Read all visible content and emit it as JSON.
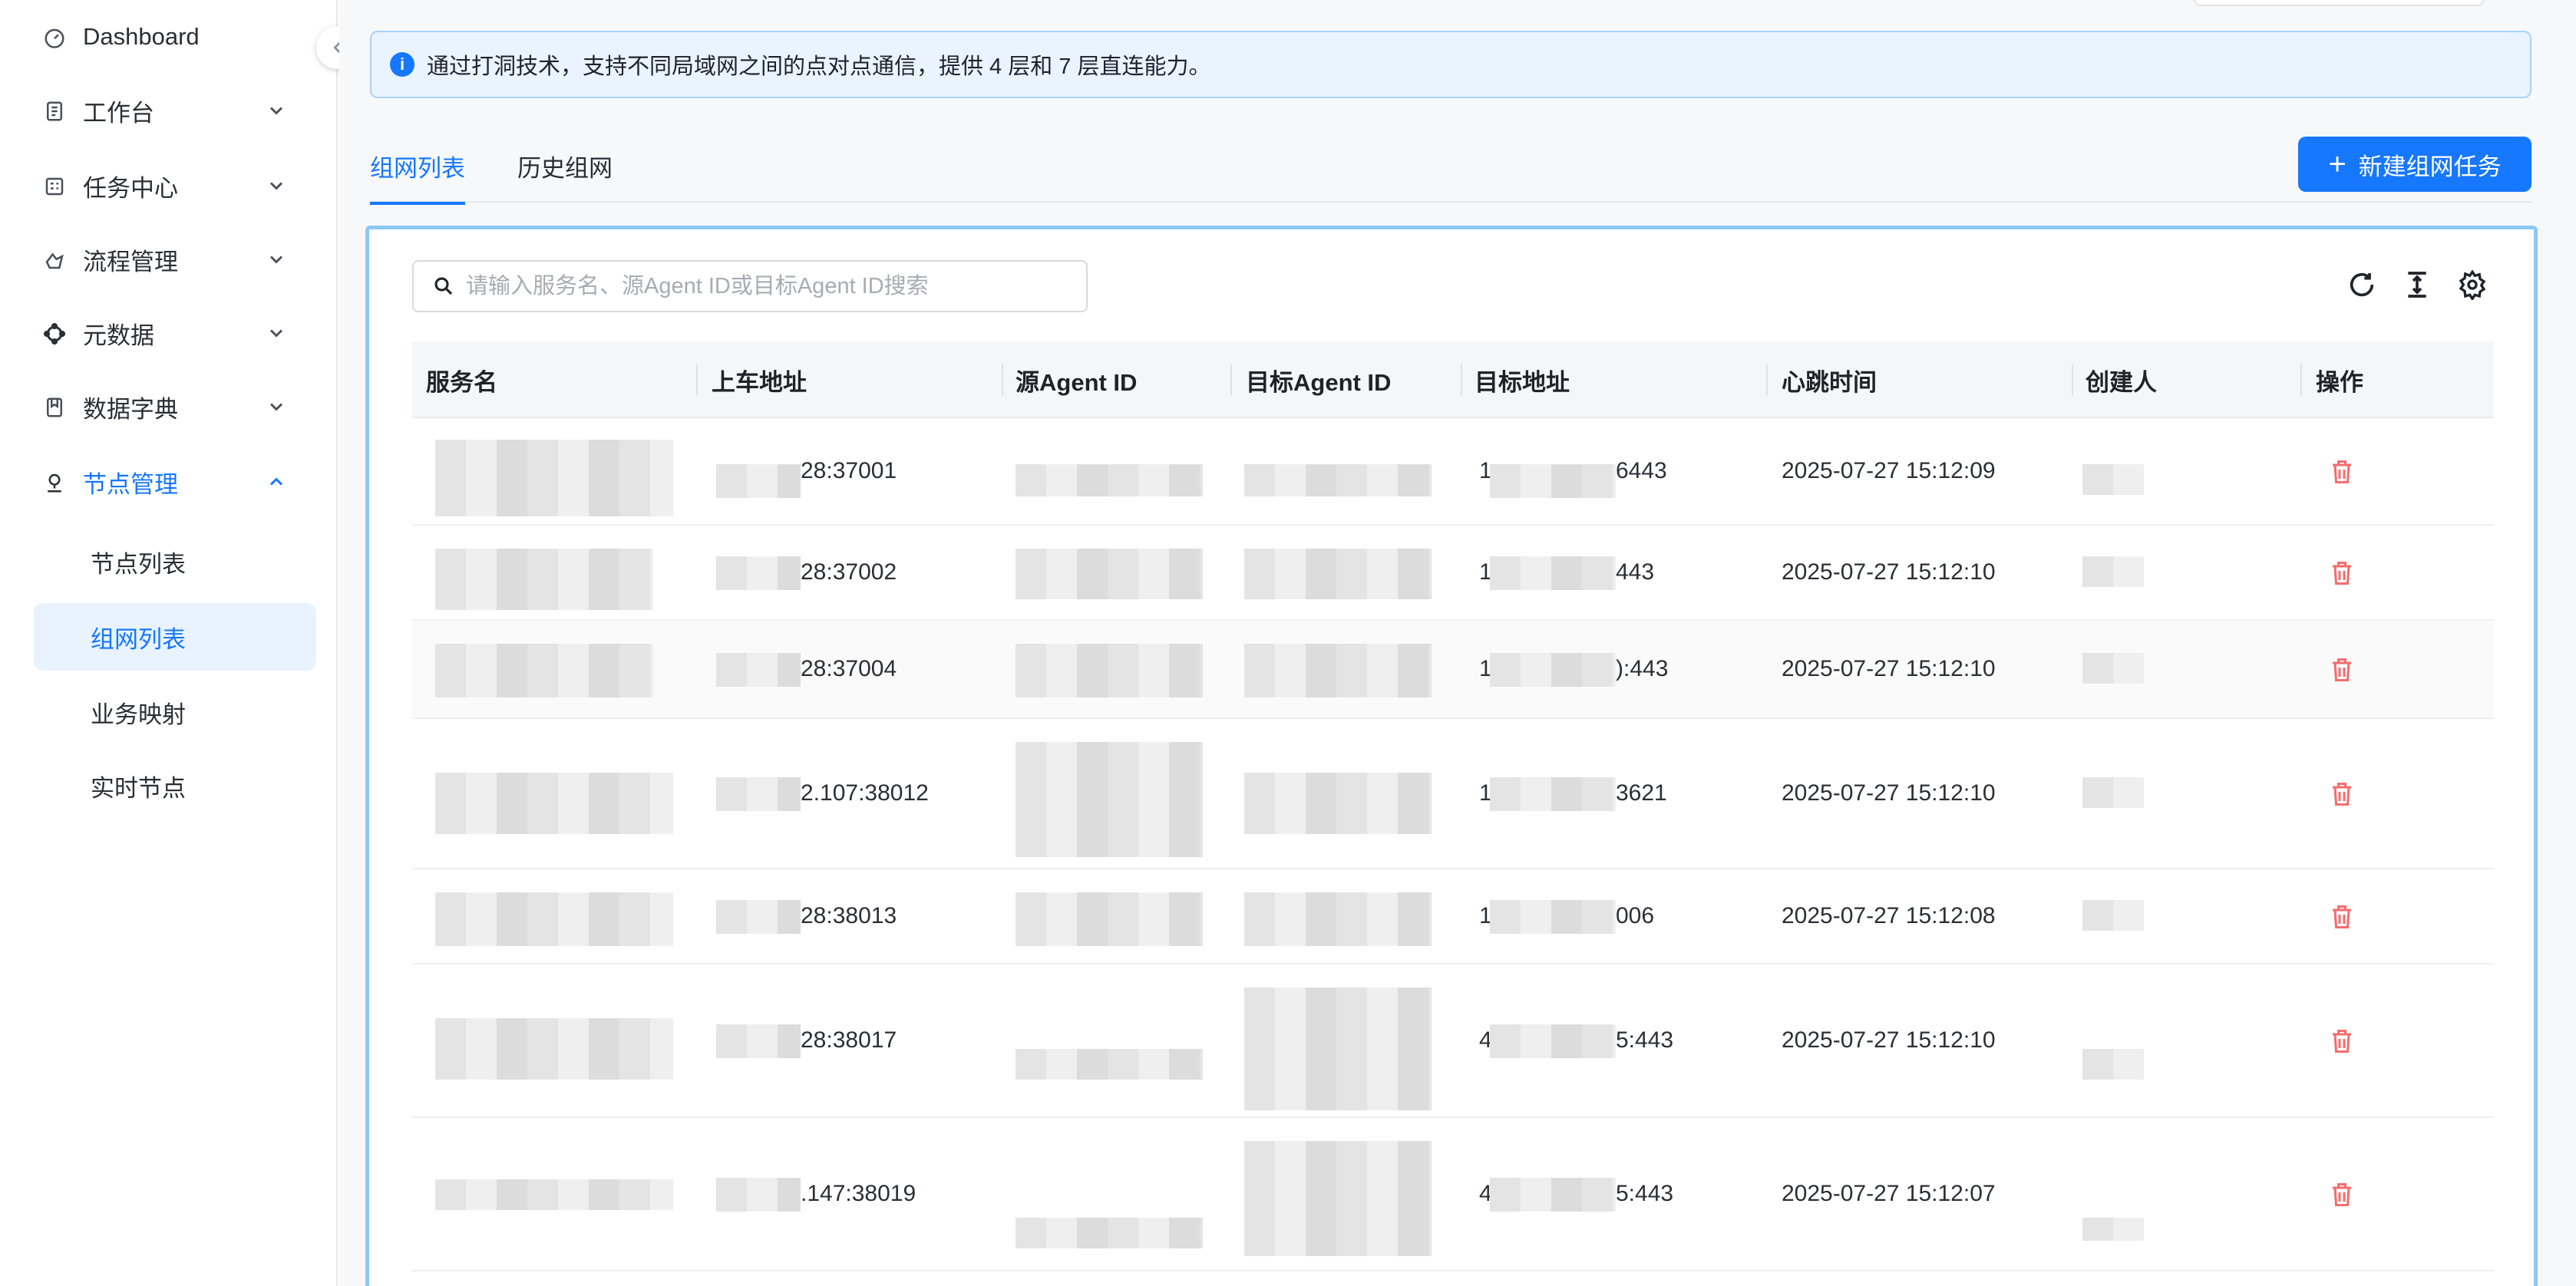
{
  "sidebar": {
    "items": [
      {
        "label": "Dashboard",
        "icon": "dashboard-icon",
        "chevron": ""
      },
      {
        "label": "工作台",
        "icon": "document-icon",
        "chevron": "down"
      },
      {
        "label": "任务中心",
        "icon": "task-icon",
        "chevron": "down"
      },
      {
        "label": "流程管理",
        "icon": "flow-icon",
        "chevron": "down"
      },
      {
        "label": "元数据",
        "icon": "metadata-icon",
        "chevron": "down"
      },
      {
        "label": "数据字典",
        "icon": "dictionary-icon",
        "chevron": "down"
      },
      {
        "label": "节点管理",
        "icon": "node-icon",
        "chevron": "up"
      }
    ],
    "sub_items": [
      {
        "label": "节点列表"
      },
      {
        "label": "组网列表"
      },
      {
        "label": "业务映射"
      },
      {
        "label": "实时节点"
      }
    ]
  },
  "alert": {
    "icon": "info-icon",
    "text": "通过打洞技术，支持不同局域网之间的点对点通信，提供 4 层和 7 层直连能力。"
  },
  "tabs": [
    {
      "label": "组网列表"
    },
    {
      "label": "历史组网"
    }
  ],
  "new_button": {
    "label": "新建组网任务"
  },
  "search": {
    "placeholder": "请输入服务名、源Agent ID或目标Agent ID搜索",
    "value": ""
  },
  "toolbar": {
    "icons": [
      "refresh-icon",
      "column-height-icon",
      "settings-icon"
    ]
  },
  "table": {
    "columns": [
      "服务名",
      "上车地址",
      "源Agent ID",
      "目标Agent ID",
      "目标地址",
      "心跳时间",
      "创建人",
      "操作"
    ],
    "rows": [
      {
        "address": "28:37001",
        "target": "6443",
        "target_prefix": "1",
        "heartbeat": "2025-07-27 15:12:09"
      },
      {
        "address": "28:37002",
        "target": "443",
        "target_prefix": "1",
        "heartbeat": "2025-07-27 15:12:10"
      },
      {
        "address": "28:37004",
        "target": "):443",
        "target_prefix": "1",
        "heartbeat": "2025-07-27 15:12:10"
      },
      {
        "address": "2.107:38012",
        "target": "3621",
        "target_prefix": "1",
        "heartbeat": "2025-07-27 15:12:10"
      },
      {
        "address": "28:38013",
        "target": "006",
        "target_prefix": "1",
        "heartbeat": "2025-07-27 15:12:08"
      },
      {
        "address": "28:38017",
        "target": "5:443",
        "target_prefix": "4",
        "heartbeat": "2025-07-27 15:12:10"
      },
      {
        "address": ".147:38019",
        "target": "5:443",
        "target_prefix": "4",
        "heartbeat": "2025-07-27 15:12:07"
      }
    ]
  },
  "colors": {
    "accent": "#1677ff",
    "danger": "#f56c6c"
  }
}
